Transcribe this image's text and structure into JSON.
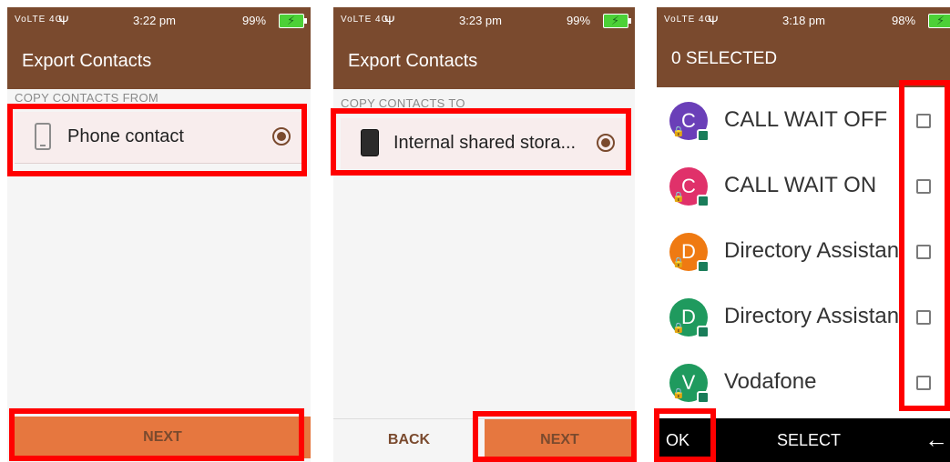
{
  "screen1": {
    "status": {
      "signal": "VoLTE 4G",
      "usb": "Ψ",
      "time": "3:22 pm",
      "battery": "99%"
    },
    "title": "Export Contacts",
    "section_label": "COPY CONTACTS FROM",
    "option": {
      "label": "Phone contact",
      "icon": "phone-icon"
    },
    "next_label": "NEXT"
  },
  "screen2": {
    "status": {
      "signal": "VoLTE 4G",
      "usb": "Ψ",
      "time": "3:23 pm",
      "battery": "99%"
    },
    "title": "Export Contacts",
    "section_label": "COPY CONTACTS TO",
    "option": {
      "label": "Internal shared stora...",
      "icon": "storage-icon"
    },
    "back_label": "BACK",
    "next_label": "NEXT"
  },
  "screen3": {
    "status": {
      "signal": "VoLTE 4G",
      "usb": "Ψ",
      "time": "3:18 pm",
      "battery": "98%"
    },
    "title": "0 SELECTED",
    "contacts": [
      {
        "initial": "C",
        "name": "CALL WAIT OFF",
        "color": "#6a3fb8"
      },
      {
        "initial": "C",
        "name": "CALL WAIT ON",
        "color": "#e0316a"
      },
      {
        "initial": "D",
        "name": "Directory Assistance",
        "color": "#ef7a12"
      },
      {
        "initial": "D",
        "name": "Directory Assistance",
        "color": "#1f9a5e"
      },
      {
        "initial": "V",
        "name": "Vodafone",
        "color": "#1f9a5e"
      }
    ],
    "softkeys": {
      "ok": "OK",
      "select": "SELECT",
      "back": "←"
    }
  },
  "colors": {
    "brand": "#7a4a2e",
    "accent": "#e6773f",
    "highlight": "#ff0000"
  }
}
